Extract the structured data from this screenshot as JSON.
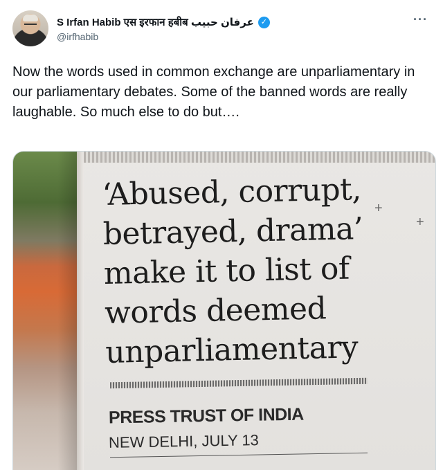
{
  "author": {
    "name": "S Irfan Habib एस इरफान हबीब عرفان حبیب",
    "verified_icon": "verified-badge-icon",
    "handle": "@irfhabib"
  },
  "more_icon": "more-horizontal-icon",
  "tweet": {
    "text": "Now the words used in common exchange are unparliamentary in our parliamentary debates. Some of the banned words are really laughable. So much else to do but…."
  },
  "media": {
    "headline": "‘Abused, corrupt, betrayed, drama’ make it to list of words deemed unparliamentary",
    "byline": "PRESS TRUST OF INDIA",
    "dateline": "NEW DELHI, JULY 13"
  },
  "colors": {
    "verified": "#1d9bf0",
    "text": "#0f1419",
    "secondary": "#536471"
  }
}
